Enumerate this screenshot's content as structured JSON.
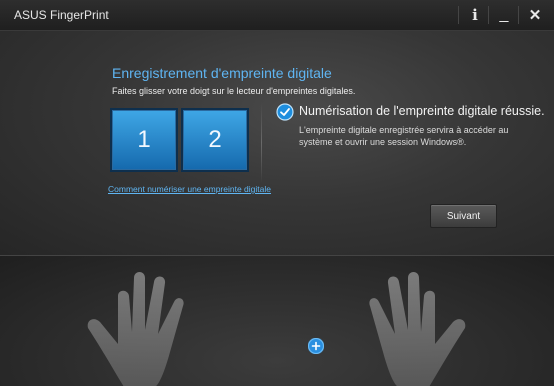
{
  "window": {
    "title": "ASUS FingerPrint",
    "info_glyph": "i",
    "minimize_glyph": "_",
    "close_glyph": "✕"
  },
  "main": {
    "heading": "Enregistrement d'empreinte digitale",
    "instruction": "Faites glisser votre doigt sur le lecteur d'empreintes digitales.",
    "tiles": [
      "1",
      "2"
    ],
    "success_title": "Numérisation de l'empreinte digitale réussie.",
    "success_desc": "L'empreinte digitale enregistrée servira à accéder au système et ouvrir une session Windows®.",
    "help_link": "Comment numériser une empreinte digitale",
    "next_label": "Suivant"
  },
  "colors": {
    "accent": "#5fb5f2",
    "tile_top": "#3fa7e6",
    "tile_bottom": "#1569ad"
  },
  "icons": {
    "success": "check-circle-icon",
    "finger_selector": "plus-circle-icon"
  }
}
